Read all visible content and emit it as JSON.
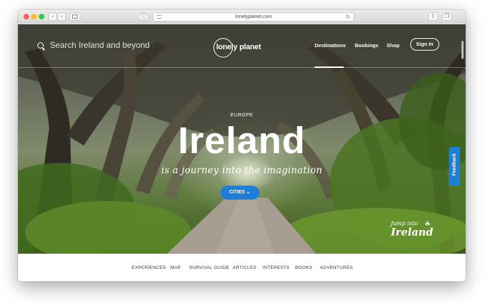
{
  "browser": {
    "url": "lonelyplanet.com",
    "nav_back": "‹",
    "nav_forward": "›",
    "reload_icon": "↻"
  },
  "header": {
    "search_placeholder": "Search Ireland and beyond",
    "logo_text": "lonely planet",
    "nav": {
      "destinations": "Destinations",
      "bookings": "Bookings",
      "shop": "Shop"
    },
    "signin": "Sign In"
  },
  "hero": {
    "kicker": "EUROPE",
    "title": "Ireland",
    "tagline": "is a journey into the imagination",
    "cities_button": "CITIES ⌄",
    "jump_small": "Jump into",
    "jump_big": "Ireland"
  },
  "feedback_label": "Feedback",
  "subnav": {
    "items": [
      "EXPERIENCES",
      "MAP",
      "SURVIVAL GUIDE",
      "ARTICLES",
      "INTERESTS",
      "BOOKS",
      "ADVENTURES"
    ]
  },
  "colors": {
    "accent_blue": "#1c7ed6"
  }
}
